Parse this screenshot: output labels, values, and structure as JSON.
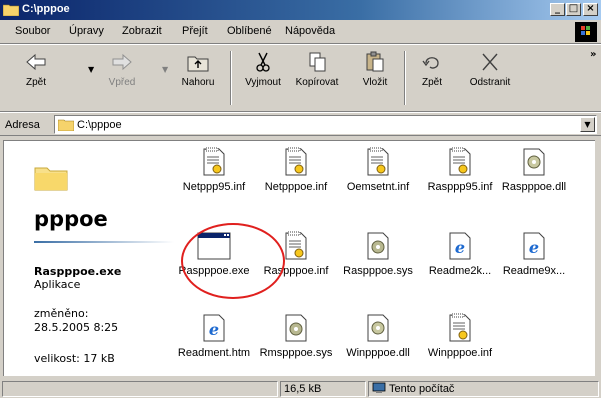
{
  "window": {
    "title": "C:\\pppoe",
    "minimize": "_",
    "maximize": "□",
    "close": "×"
  },
  "menu": {
    "items": [
      {
        "label": "Soubor"
      },
      {
        "label": "Úpravy"
      },
      {
        "label": "Zobrazit"
      },
      {
        "label": "Přejít"
      },
      {
        "label": "Oblíbené"
      },
      {
        "label": "Nápověda"
      }
    ]
  },
  "toolbar": {
    "back": "Zpět",
    "forward": "Vpřed",
    "up": "Nahoru",
    "cut": "Vyjmout",
    "copy": "Kopírovat",
    "paste": "Vložit",
    "undo": "Zpět",
    "delete": "Odstranit",
    "more": "»"
  },
  "address": {
    "label": "Adresa",
    "value": "C:\\pppoe"
  },
  "left_panel": {
    "folder_name": "pppoe",
    "selected_name": "Raspppoe.exe",
    "selected_type": "Aplikace",
    "modified_label": "změněno:",
    "modified_date": "28.5.2005 8:25",
    "size": "velikost: 17 kB"
  },
  "files": [
    {
      "name": "Netppp95.inf",
      "icon": "inf-icon"
    },
    {
      "name": "Netpppoe.inf",
      "icon": "inf-icon"
    },
    {
      "name": "Oemsetnt.inf",
      "icon": "inf-icon"
    },
    {
      "name": "Rasppp95.inf",
      "icon": "inf-icon"
    },
    {
      "name": "Raspppoe.dll",
      "icon": "dll-icon"
    },
    {
      "name": "Raspppoe.exe",
      "icon": "exe-icon"
    },
    {
      "name": "Raspppoe.inf",
      "icon": "inf-icon"
    },
    {
      "name": "Raspppoe.sys",
      "icon": "sys-icon"
    },
    {
      "name": "Readme2k...",
      "icon": "ie-icon"
    },
    {
      "name": "Readme9x...",
      "icon": "ie-icon"
    },
    {
      "name": "Readment.htm",
      "icon": "ie-icon"
    },
    {
      "name": "Rmspppoe.sys",
      "icon": "sys-icon"
    },
    {
      "name": "Winpppoe.dll",
      "icon": "dll-icon"
    },
    {
      "name": "Winpppoe.inf",
      "icon": "inf-icon"
    }
  ],
  "status": {
    "size": "16,5 kB",
    "location": "Tento počítač"
  }
}
